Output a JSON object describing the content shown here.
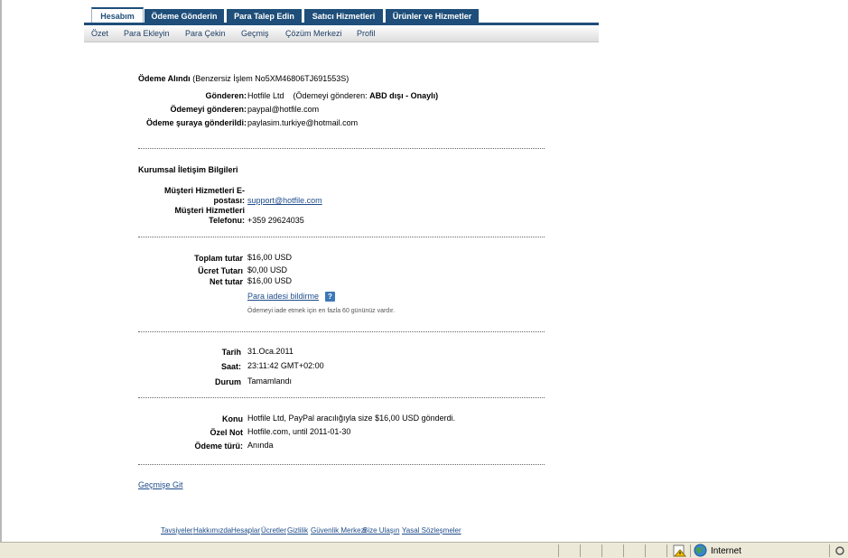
{
  "tabs": [
    "Hesabım",
    "Ödeme Gönderin",
    "Para Talep Edin",
    "Satıcı Hizmetleri",
    "Ürünler ve Hizmetler"
  ],
  "subnav": [
    "Özet",
    "Para Ekleyin",
    "Para Çekin",
    "Geçmiş",
    "Çözüm Merkezi",
    "Profil"
  ],
  "payment": {
    "title": "Ödeme Alındı",
    "tx": "(Benzersiz İşlem No5XM46806TJ691553S)",
    "sender_label": "Gönderen:",
    "sender_value": "Hotfile Ltd",
    "sender_status_prefix": "(Ödemeyi gönderen:",
    "sender_status_bold": "ABD dışı - Onaylı)",
    "from_label": "Ödemeyi gönderen:",
    "from_value": "paypal@hotfile.com",
    "to_label": "Ödeme şuraya gönderildi:",
    "to_value": "paylasim.turkiye@hotmail.com"
  },
  "corporate": {
    "title": "Kurumsal İletişim Bilgileri",
    "email_label_1": "Müşteri Hizmetleri E-",
    "email_label_2": "postası:",
    "email_value": "support@hotfile.com",
    "phone_label_1": "Müşteri Hizmetleri",
    "phone_label_2": "Telefonu:",
    "phone_value": "+359 29624035"
  },
  "amounts": {
    "total_label": "Toplam tutar",
    "total_value": "$16,00 USD",
    "fee_label": "Ücret Tutarı",
    "fee_value": "$0,00 USD",
    "net_label": "Net tutar",
    "net_value": "$16,00 USD",
    "refund_link": "Para iadesi bildirme",
    "help_icon": "?",
    "refund_note": "Ödemeyi iade etmek için en fazla 60 gününüz vardır."
  },
  "timing": {
    "date_label": "Tarih",
    "date_value": "31.Oca.2011",
    "time_label": "Saat:",
    "time_value": "23:11:42 GMT+02:00",
    "status_label": "Durum",
    "status_value": "Tamamlandı"
  },
  "details": {
    "subject_label": "Konu",
    "subject_value": "Hotfile Ltd, PayPal aracılığıyla size $16,00 USD gönderdi.",
    "note_label": "Özel Not",
    "note_value": "Hotfile.com, until 2011-01-30",
    "type_label": "Ödeme türü:",
    "type_value": "Anında"
  },
  "back_link": "Geçmişe Git",
  "footer": [
    "Tavsiyeler",
    "Hakkımızda",
    "Hesaplar",
    "Ücretler",
    "Gizlilik",
    "Güvenlik Merkezi",
    "Bize Ulaşın",
    "Yasal Sözleşmeler"
  ],
  "statusbar": {
    "zone": "Internet"
  },
  "colors": {
    "tab_bg": "#1e4e79",
    "link": "#1f4c8a"
  }
}
